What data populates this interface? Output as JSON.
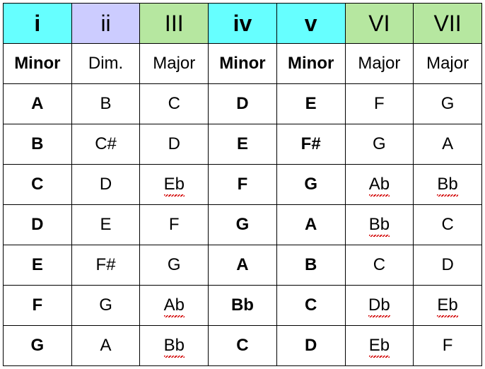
{
  "roman": [
    "i",
    "ii",
    "III",
    "iv",
    "v",
    "VI",
    "VII"
  ],
  "quality": [
    "Minor",
    "Dim.",
    "Major",
    "Minor",
    "Minor",
    "Major",
    "Major"
  ],
  "rows": [
    [
      "A",
      "B",
      "C",
      "D",
      "E",
      "F",
      "G"
    ],
    [
      "B",
      "C#",
      "D",
      "E",
      "F#",
      "G",
      "A"
    ],
    [
      "C",
      "D",
      "Eb",
      "F",
      "G",
      "Ab",
      "Bb"
    ],
    [
      "D",
      "E",
      "F",
      "G",
      "A",
      "Bb",
      "C"
    ],
    [
      "E",
      "F#",
      "G",
      "A",
      "B",
      "C",
      "D"
    ],
    [
      "F",
      "G",
      "Ab",
      "Bb",
      "C",
      "Db",
      "Eb"
    ],
    [
      "G",
      "A",
      "Bb",
      "C",
      "D",
      "Eb",
      "F"
    ]
  ],
  "header_classes": [
    "hdr-teal",
    "hdr-lav",
    "hdr-green",
    "hdr-teal",
    "hdr-teal",
    "hdr-green",
    "hdr-green"
  ],
  "bold_cols": [
    true,
    false,
    false,
    true,
    true,
    false,
    false
  ],
  "quality_bold": [
    true,
    false,
    false,
    true,
    true,
    false,
    false
  ],
  "spell_cells": {
    "2": [
      2,
      5,
      6
    ],
    "3": [
      5
    ],
    "5": [
      2,
      5,
      6
    ],
    "6": [
      2,
      5
    ]
  }
}
